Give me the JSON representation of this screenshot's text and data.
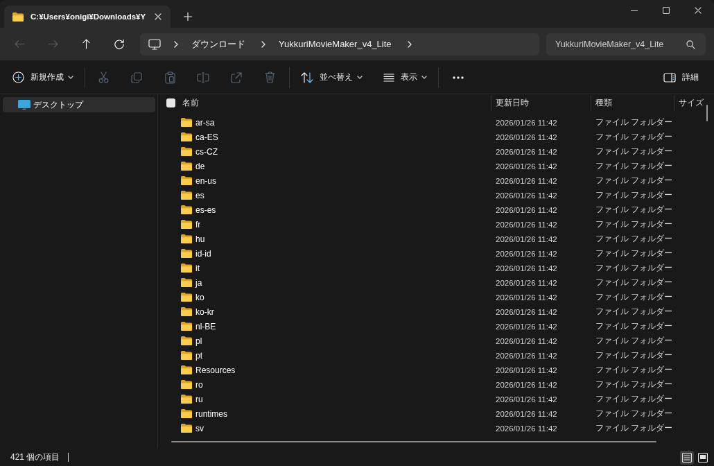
{
  "tabs": [
    {
      "title": "C:¥Users¥onigi¥Downloads¥Y",
      "selected": true
    }
  ],
  "nav_buttons": [
    {
      "kind": "back",
      "disabled": true
    },
    {
      "kind": "forward",
      "disabled": true
    },
    {
      "kind": "up",
      "disabled": false
    },
    {
      "kind": "refresh",
      "disabled": false
    }
  ],
  "address_bar": {
    "segments": [
      "ダウンロード",
      "YukkuriMovieMaker_v4_Lite"
    ]
  },
  "search": {
    "placeholder": "YukkuriMovieMaker_v4_Lite"
  },
  "toolbar": {
    "groups": [
      [
        {
          "kind": "new",
          "label": "新規作成",
          "disabled": false
        }
      ],
      [
        {
          "kind": "cut",
          "disabled": true
        },
        {
          "kind": "copy",
          "disabled": true
        },
        {
          "kind": "paste",
          "disabled": true
        },
        {
          "kind": "rename",
          "disabled": true
        },
        {
          "kind": "share",
          "disabled": true
        },
        {
          "kind": "delete",
          "disabled": true
        }
      ],
      [
        {
          "kind": "sort",
          "label": "並べ替え",
          "disabled": false
        },
        {
          "kind": "view",
          "label": "表示",
          "disabled": false
        }
      ],
      [
        {
          "kind": "more",
          "disabled": false
        }
      ]
    ],
    "details": {
      "label": "詳細"
    }
  },
  "sidebar": {
    "items": [
      {
        "label": "デスクトップ",
        "selected": true
      }
    ]
  },
  "table": {
    "select_all": {
      "checked": false
    },
    "columns": [
      "名前",
      "更新日時",
      "種類",
      "サイズ"
    ],
    "rows": [
      {
        "name": "ar-sa",
        "modified": "2026/01/26 11:42",
        "type": "ファイル フォルダー"
      },
      {
        "name": "ca-ES",
        "modified": "2026/01/26 11:42",
        "type": "ファイル フォルダー"
      },
      {
        "name": "cs-CZ",
        "modified": "2026/01/26 11:42",
        "type": "ファイル フォルダー"
      },
      {
        "name": "de",
        "modified": "2026/01/26 11:42",
        "type": "ファイル フォルダー"
      },
      {
        "name": "en-us",
        "modified": "2026/01/26 11:42",
        "type": "ファイル フォルダー"
      },
      {
        "name": "es",
        "modified": "2026/01/26 11:42",
        "type": "ファイル フォルダー"
      },
      {
        "name": "es-es",
        "modified": "2026/01/26 11:42",
        "type": "ファイル フォルダー"
      },
      {
        "name": "fr",
        "modified": "2026/01/26 11:42",
        "type": "ファイル フォルダー"
      },
      {
        "name": "hu",
        "modified": "2026/01/26 11:42",
        "type": "ファイル フォルダー"
      },
      {
        "name": "id-id",
        "modified": "2026/01/26 11:42",
        "type": "ファイル フォルダー"
      },
      {
        "name": "it",
        "modified": "2026/01/26 11:42",
        "type": "ファイル フォルダー"
      },
      {
        "name": "ja",
        "modified": "2026/01/26 11:42",
        "type": "ファイル フォルダー"
      },
      {
        "name": "ko",
        "modified": "2026/01/26 11:42",
        "type": "ファイル フォルダー"
      },
      {
        "name": "ko-kr",
        "modified": "2026/01/26 11:42",
        "type": "ファイル フォルダー"
      },
      {
        "name": "nl-BE",
        "modified": "2026/01/26 11:42",
        "type": "ファイル フォルダー"
      },
      {
        "name": "pl",
        "modified": "2026/01/26 11:42",
        "type": "ファイル フォルダー"
      },
      {
        "name": "pt",
        "modified": "2026/01/26 11:42",
        "type": "ファイル フォルダー"
      },
      {
        "name": "Resources",
        "modified": "2026/01/26 11:42",
        "type": "ファイル フォルダー"
      },
      {
        "name": "ro",
        "modified": "2026/01/26 11:42",
        "type": "ファイル フォルダー"
      },
      {
        "name": "ru",
        "modified": "2026/01/26 11:42",
        "type": "ファイル フォルダー"
      },
      {
        "name": "runtimes",
        "modified": "2026/01/26 11:42",
        "type": "ファイル フォルダー"
      },
      {
        "name": "sv",
        "modified": "2026/01/26 11:42",
        "type": "ファイル フォルダー"
      }
    ]
  },
  "status_bar": {
    "count": "421 個の項目",
    "views": [
      {
        "kind": "details",
        "selected": true
      },
      {
        "kind": "tiles",
        "selected": false
      }
    ]
  }
}
